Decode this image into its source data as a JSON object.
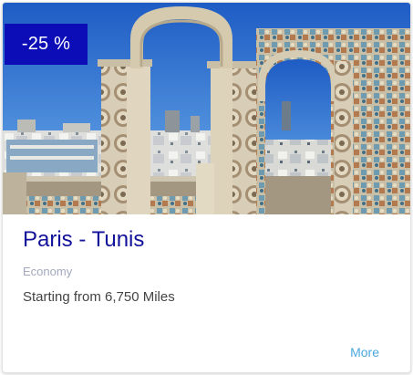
{
  "offer": {
    "discount": "-25 %",
    "title": "Paris - Tunis",
    "category": "Economy",
    "price_text": "Starting from 6,750 Miles",
    "more_label": "More"
  },
  "colors": {
    "badge_bg": "#0d0db8",
    "title": "#12129a",
    "category": "#a3a9be",
    "link": "#4ba8df"
  }
}
